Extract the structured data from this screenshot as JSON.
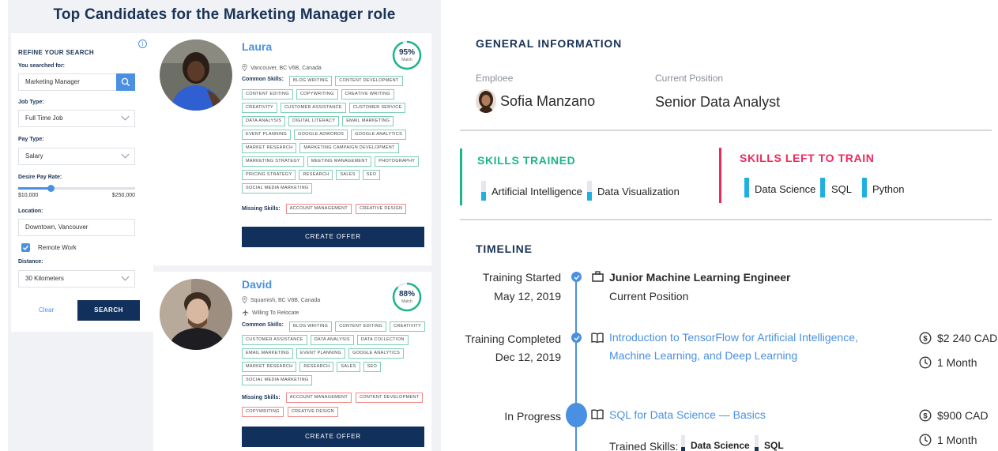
{
  "left": {
    "page_title": "Top Candidates for the Marketing Manager role",
    "filters": {
      "heading": "REFINE YOUR SEARCH",
      "searched_label": "You searched for:",
      "searched_value": "Marketing Manager",
      "job_type_label": "Job Type:",
      "job_type_value": "Full Time Job",
      "pay_type_label": "Pay Type:",
      "pay_type_value": "Salary",
      "pay_rate_label": "Desire Pay Rate:",
      "pay_rate_fraction": 0.28,
      "pay_min": "$10,000",
      "pay_max": "$250,000",
      "location_label": "Location:",
      "location_value": "Downtown, Vancouver",
      "remote_label": "Remote Work",
      "remote_checked": true,
      "distance_label": "Distance:",
      "distance_value": "30 Kilometers",
      "clear_label": "Clear",
      "search_label": "SEARCH"
    },
    "candidates": [
      {
        "name": "Laura",
        "match_pct": "95%",
        "match_fraction": 0.95,
        "match_label": "Match",
        "location": "Vancouver, BC V6B, Canada",
        "common_label": "Common Skills:",
        "skills": [
          "BLOG WRITING",
          "CONTENT DEVELOPMENT",
          "CONTENT EDITING",
          "COPYWRITING",
          "CREATIVE WRITING",
          "CREATIVITY",
          "CUSTOMER ASSISTANCE",
          "CUSTOMER SERVICE",
          "DATA ANALYSIS",
          "DIGITAL LITERACY",
          "EMAIL MARKETING",
          "EVENT PLANNING",
          "GOOGLE ADWORDS",
          "GOOGLE ANALYTICS",
          "MARKET RESEARCH",
          "MARKETING CAMPAIGN DEVELOPMENT",
          "MARKETING STRATEGY",
          "MEETING MANAGEMENT",
          "PHOTOGRAPHY",
          "PRICING STRATEGY",
          "RESEARCH",
          "SALES",
          "SEO",
          "SOCIAL MEDIA MARKETING"
        ],
        "missing_label": "Missing Skills:",
        "missing": [
          "ACCOUNT MANAGEMENT",
          "CREATIVE DESIGN"
        ],
        "offer_label": "CREATE OFFER"
      },
      {
        "name": "David",
        "match_pct": "88%",
        "match_fraction": 0.88,
        "match_label": "Match",
        "location": "Squamish, BC V8B, Canada",
        "relocate": "Willing To Relocate",
        "common_label": "Common Skills:",
        "skills": [
          "BLOG WRITING",
          "CONTENT EDITING",
          "CREATIVITY",
          "CUSTOMER ASSISTANCE",
          "DATA ANALYSIS",
          "DATA COLLECTION",
          "EMAIL MARKETING",
          "EVENT PLANNING",
          "GOOGLE ANALYTICS",
          "MARKET RESEARCH",
          "RESEARCH",
          "SALES",
          "SEO",
          "SOCIAL MEDIA MARKETING"
        ],
        "missing_label": "Missing Skills:",
        "missing": [
          "ACCOUNT MANAGEMENT",
          "CONTENT DEVELOPMENT",
          "COPYWRITING",
          "CREATIVE DESIGN"
        ],
        "offer_label": "CREATE OFFER"
      }
    ]
  },
  "right": {
    "general_title": "GENERAL INFORMATION",
    "employee_label": "Emploee",
    "employee_name": "Sofia Manzano",
    "position_label": "Current Position",
    "position_value": "Senior Data Analyst",
    "trained_title": "SKILLS TRAINED",
    "trained": [
      "Artificial Intelligence",
      "Data Visualization"
    ],
    "left_title": "SKILLS LEFT TO TRAIN",
    "left_to_train": [
      "Data Science",
      "SQL",
      "Python"
    ],
    "timeline_title": "TIMELINE",
    "timeline": [
      {
        "status": "Training Started",
        "date": "May 12, 2019",
        "title": "Junior Machine Learning Engineer",
        "subtitle": "Current Position"
      },
      {
        "status": "Training Completed",
        "date": "Dec 12, 2019",
        "course": "Introduction to TensorFlow for Artificial Intelligence, Machine Learning, and Deep Learning",
        "price": "$2 240 CAD",
        "duration": "1 Month"
      },
      {
        "status": "In Progress",
        "course": "SQL for Data Science — Basics",
        "price": "$900 CAD",
        "duration": "1 Month",
        "trained_label": "Trained Skills:",
        "trained_skills": [
          "Data Science",
          "SQL"
        ]
      }
    ],
    "colors": {
      "green": "#1bb58a",
      "pink": "#f0285a",
      "blue": "#4a90e2",
      "navy": "#1a3357"
    }
  }
}
